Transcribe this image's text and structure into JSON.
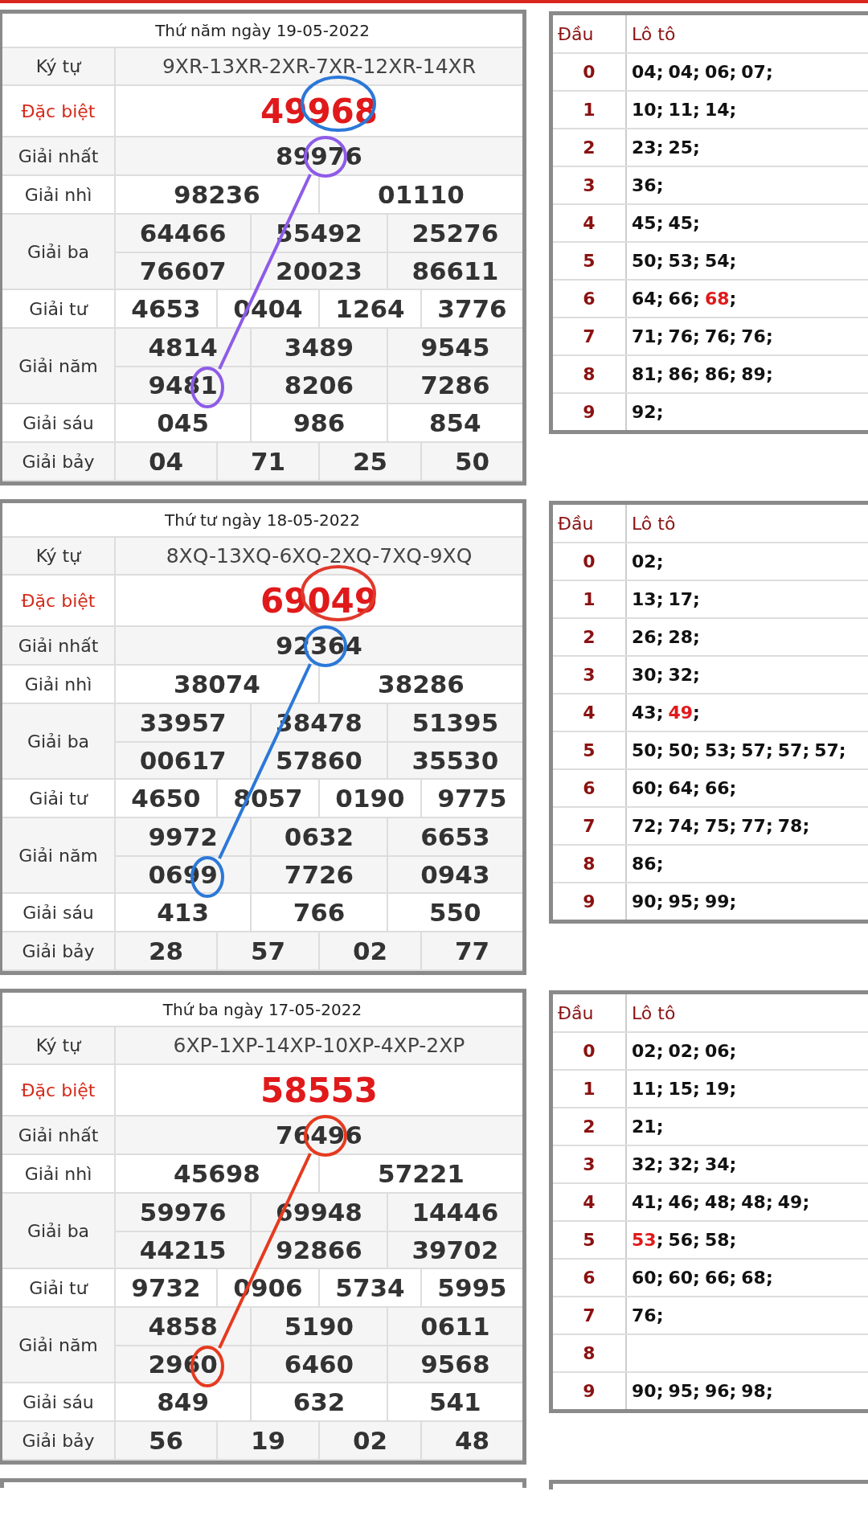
{
  "results": [
    {
      "date_title": "Thứ năm ngày 19-05-2022",
      "prizes": [
        {
          "label": "Ký tự",
          "kind": "code",
          "values": [
            "9XR-13XR-2XR-7XR-12XR-14XR"
          ]
        },
        {
          "label": "Đặc biệt",
          "kind": "special",
          "values": [
            "49968"
          ]
        },
        {
          "label": "Giải nhất",
          "kind": "normal",
          "values": [
            "89976"
          ]
        },
        {
          "label": "Giải nhì",
          "kind": "normal",
          "values": [
            "98236",
            "01110"
          ]
        },
        {
          "label": "Giải ba",
          "kind": "normal",
          "values": [
            "64466",
            "55492",
            "25276",
            "76607",
            "20023",
            "86611"
          ]
        },
        {
          "label": "Giải tư",
          "kind": "normal",
          "values": [
            "4653",
            "0404",
            "1264",
            "3776"
          ]
        },
        {
          "label": "Giải năm",
          "kind": "normal",
          "values": [
            "4814",
            "3489",
            "9545",
            "9481",
            "8206",
            "7286"
          ]
        },
        {
          "label": "Giải sáu",
          "kind": "normal",
          "values": [
            "045",
            "986",
            "854"
          ]
        },
        {
          "label": "Giải bảy",
          "kind": "normal",
          "values": [
            "04",
            "71",
            "25",
            "50"
          ]
        }
      ],
      "special_circle": {
        "color": "#2b78d8"
      },
      "link": {
        "color": "#8e5be8"
      },
      "loto": {
        "headers": [
          "Đầu",
          "Lô tô"
        ],
        "rows": [
          {
            "head": "0",
            "numbers": [
              {
                "text": "04",
                "sep": ";",
                "special": false
              },
              {
                "text": "04",
                "sep": ";",
                "special": false
              },
              {
                "text": "06",
                "sep": ";",
                "special": false
              },
              {
                "text": "07",
                "sep": ";",
                "special": false
              }
            ]
          },
          {
            "head": "1",
            "numbers": [
              {
                "text": "10",
                "sep": ";",
                "special": false
              },
              {
                "text": "11",
                "sep": ";",
                "special": false
              },
              {
                "text": "14",
                "sep": ";",
                "special": false
              }
            ]
          },
          {
            "head": "2",
            "numbers": [
              {
                "text": "23",
                "sep": ";",
                "special": false
              },
              {
                "text": "25",
                "sep": ";",
                "special": false
              }
            ]
          },
          {
            "head": "3",
            "numbers": [
              {
                "text": "36",
                "sep": ";",
                "special": false
              }
            ]
          },
          {
            "head": "4",
            "numbers": [
              {
                "text": "45",
                "sep": ";",
                "special": false
              },
              {
                "text": "45",
                "sep": ";",
                "special": false
              }
            ]
          },
          {
            "head": "5",
            "numbers": [
              {
                "text": "50",
                "sep": ";",
                "special": false
              },
              {
                "text": "53",
                "sep": ";",
                "special": false
              },
              {
                "text": "54",
                "sep": ";",
                "special": false
              }
            ]
          },
          {
            "head": "6",
            "numbers": [
              {
                "text": "64",
                "sep": ";",
                "special": false
              },
              {
                "text": "66",
                "sep": ";",
                "special": false
              },
              {
                "text": "68",
                "sep": ";",
                "special": true
              }
            ]
          },
          {
            "head": "7",
            "numbers": [
              {
                "text": "71",
                "sep": ";",
                "special": false
              },
              {
                "text": "76",
                "sep": ";",
                "special": false
              },
              {
                "text": "76",
                "sep": ";",
                "special": false
              },
              {
                "text": "76",
                "sep": ";",
                "special": false
              }
            ]
          },
          {
            "head": "8",
            "numbers": [
              {
                "text": "81",
                "sep": ";",
                "special": false
              },
              {
                "text": "86",
                "sep": ";",
                "special": false
              },
              {
                "text": "86",
                "sep": ";",
                "special": false
              },
              {
                "text": "89",
                "sep": ";",
                "special": false
              }
            ]
          },
          {
            "head": "9",
            "numbers": [
              {
                "text": "92",
                "sep": ";",
                "special": false
              }
            ]
          }
        ]
      }
    },
    {
      "date_title": "Thứ tư ngày 18-05-2022",
      "prizes": [
        {
          "label": "Ký tự",
          "kind": "code",
          "values": [
            "8XQ-13XQ-6XQ-2XQ-7XQ-9XQ"
          ]
        },
        {
          "label": "Đặc biệt",
          "kind": "special",
          "values": [
            "69049"
          ]
        },
        {
          "label": "Giải nhất",
          "kind": "normal",
          "values": [
            "92364"
          ]
        },
        {
          "label": "Giải nhì",
          "kind": "normal",
          "values": [
            "38074",
            "38286"
          ]
        },
        {
          "label": "Giải ba",
          "kind": "normal",
          "values": [
            "33957",
            "38478",
            "51395",
            "00617",
            "57860",
            "35530"
          ]
        },
        {
          "label": "Giải tư",
          "kind": "normal",
          "values": [
            "4650",
            "8057",
            "0190",
            "9775"
          ]
        },
        {
          "label": "Giải năm",
          "kind": "normal",
          "values": [
            "9972",
            "0632",
            "6653",
            "0699",
            "7726",
            "0943"
          ]
        },
        {
          "label": "Giải sáu",
          "kind": "normal",
          "values": [
            "413",
            "766",
            "550"
          ]
        },
        {
          "label": "Giải bảy",
          "kind": "normal",
          "values": [
            "28",
            "57",
            "02",
            "77"
          ]
        }
      ],
      "special_circle": {
        "color": "#e0392b"
      },
      "link": {
        "color": "#2b78d8"
      },
      "loto": {
        "headers": [
          "Đầu",
          "Lô tô"
        ],
        "rows": [
          {
            "head": "0",
            "numbers": [
              {
                "text": "02",
                "sep": ";",
                "special": false
              }
            ]
          },
          {
            "head": "1",
            "numbers": [
              {
                "text": "13",
                "sep": ";",
                "special": false
              },
              {
                "text": "17",
                "sep": ";",
                "special": false
              }
            ]
          },
          {
            "head": "2",
            "numbers": [
              {
                "text": "26",
                "sep": ";",
                "special": false
              },
              {
                "text": "28",
                "sep": ";",
                "special": false
              }
            ]
          },
          {
            "head": "3",
            "numbers": [
              {
                "text": "30",
                "sep": ";",
                "special": false
              },
              {
                "text": "32",
                "sep": ";",
                "special": false
              }
            ]
          },
          {
            "head": "4",
            "numbers": [
              {
                "text": "43",
                "sep": ";",
                "special": false
              },
              {
                "text": "49",
                "sep": ";",
                "special": true
              }
            ]
          },
          {
            "head": "5",
            "numbers": [
              {
                "text": "50",
                "sep": ";",
                "special": false
              },
              {
                "text": "50",
                "sep": ";",
                "special": false
              },
              {
                "text": "53",
                "sep": ";",
                "special": false
              },
              {
                "text": "57",
                "sep": ";",
                "special": false
              },
              {
                "text": "57",
                "sep": ";",
                "special": false
              },
              {
                "text": "57",
                "sep": ";",
                "special": false
              }
            ]
          },
          {
            "head": "6",
            "numbers": [
              {
                "text": "60",
                "sep": ";",
                "special": false
              },
              {
                "text": "64",
                "sep": ";",
                "special": false
              },
              {
                "text": "66",
                "sep": ";",
                "special": false
              }
            ]
          },
          {
            "head": "7",
            "numbers": [
              {
                "text": "72",
                "sep": ";",
                "special": false
              },
              {
                "text": "74",
                "sep": ";",
                "special": false
              },
              {
                "text": "75",
                "sep": ";",
                "special": false
              },
              {
                "text": "77",
                "sep": ";",
                "special": false
              },
              {
                "text": "78",
                "sep": ";",
                "special": false
              }
            ]
          },
          {
            "head": "8",
            "numbers": [
              {
                "text": "86",
                "sep": ";",
                "special": false
              }
            ]
          },
          {
            "head": "9",
            "numbers": [
              {
                "text": "90",
                "sep": ";",
                "special": false
              },
              {
                "text": "95",
                "sep": ";",
                "special": false
              },
              {
                "text": "99",
                "sep": ";",
                "special": false
              }
            ]
          }
        ]
      }
    },
    {
      "date_title": "Thứ ba ngày 17-05-2022",
      "prizes": [
        {
          "label": "Ký tự",
          "kind": "code",
          "values": [
            "6XP-1XP-14XP-10XP-4XP-2XP"
          ]
        },
        {
          "label": "Đặc biệt",
          "kind": "special",
          "values": [
            "58553"
          ]
        },
        {
          "label": "Giải nhất",
          "kind": "normal",
          "values": [
            "76496"
          ]
        },
        {
          "label": "Giải nhì",
          "kind": "normal",
          "values": [
            "45698",
            "57221"
          ]
        },
        {
          "label": "Giải ba",
          "kind": "normal",
          "values": [
            "59976",
            "69948",
            "14446",
            "44215",
            "92866",
            "39702"
          ]
        },
        {
          "label": "Giải tư",
          "kind": "normal",
          "values": [
            "9732",
            "0906",
            "5734",
            "5995"
          ]
        },
        {
          "label": "Giải năm",
          "kind": "normal",
          "values": [
            "4858",
            "5190",
            "0611",
            "2960",
            "6460",
            "9568"
          ]
        },
        {
          "label": "Giải sáu",
          "kind": "normal",
          "values": [
            "849",
            "632",
            "541"
          ]
        },
        {
          "label": "Giải bảy",
          "kind": "normal",
          "values": [
            "56",
            "19",
            "02",
            "48"
          ]
        }
      ],
      "link": {
        "color": "#e53a1f"
      },
      "loto": {
        "headers": [
          "Đầu",
          "Lô tô"
        ],
        "rows": [
          {
            "head": "0",
            "numbers": [
              {
                "text": "02",
                "sep": ";",
                "special": false
              },
              {
                "text": "02",
                "sep": ";",
                "special": false
              },
              {
                "text": "06",
                "sep": ";",
                "special": false
              }
            ]
          },
          {
            "head": "1",
            "numbers": [
              {
                "text": "11",
                "sep": ";",
                "special": false
              },
              {
                "text": "15",
                "sep": ";",
                "special": false
              },
              {
                "text": "19",
                "sep": ";",
                "special": false
              }
            ]
          },
          {
            "head": "2",
            "numbers": [
              {
                "text": "21",
                "sep": ";",
                "special": false
              }
            ]
          },
          {
            "head": "3",
            "numbers": [
              {
                "text": "32",
                "sep": ";",
                "special": false
              },
              {
                "text": "32",
                "sep": ";",
                "special": false
              },
              {
                "text": "34",
                "sep": ";",
                "special": false
              }
            ]
          },
          {
            "head": "4",
            "numbers": [
              {
                "text": "41",
                "sep": ";",
                "special": false
              },
              {
                "text": "46",
                "sep": ";",
                "special": false
              },
              {
                "text": "48",
                "sep": ";",
                "special": false
              },
              {
                "text": "48",
                "sep": ";",
                "special": false
              },
              {
                "text": "49",
                "sep": ";",
                "special": false
              }
            ]
          },
          {
            "head": "5",
            "numbers": [
              {
                "text": "53",
                "sep": ";",
                "special": true
              },
              {
                "text": "56",
                "sep": ";",
                "special": false
              },
              {
                "text": "58",
                "sep": ";",
                "special": false
              }
            ]
          },
          {
            "head": "6",
            "numbers": [
              {
                "text": "60",
                "sep": ";",
                "special": false
              },
              {
                "text": "60",
                "sep": ";",
                "special": false
              },
              {
                "text": "66",
                "sep": ";",
                "special": false
              },
              {
                "text": "68",
                "sep": ";",
                "special": false
              }
            ]
          },
          {
            "head": "7",
            "numbers": [
              {
                "text": "76",
                "sep": ";",
                "special": false
              }
            ]
          },
          {
            "head": "8",
            "numbers": []
          },
          {
            "head": "9",
            "numbers": [
              {
                "text": "90",
                "sep": ";",
                "special": false
              },
              {
                "text": "95",
                "sep": ";",
                "special": false
              },
              {
                "text": "96",
                "sep": ";",
                "special": false
              },
              {
                "text": "98",
                "sep": ";",
                "special": false
              }
            ]
          }
        ]
      }
    }
  ]
}
